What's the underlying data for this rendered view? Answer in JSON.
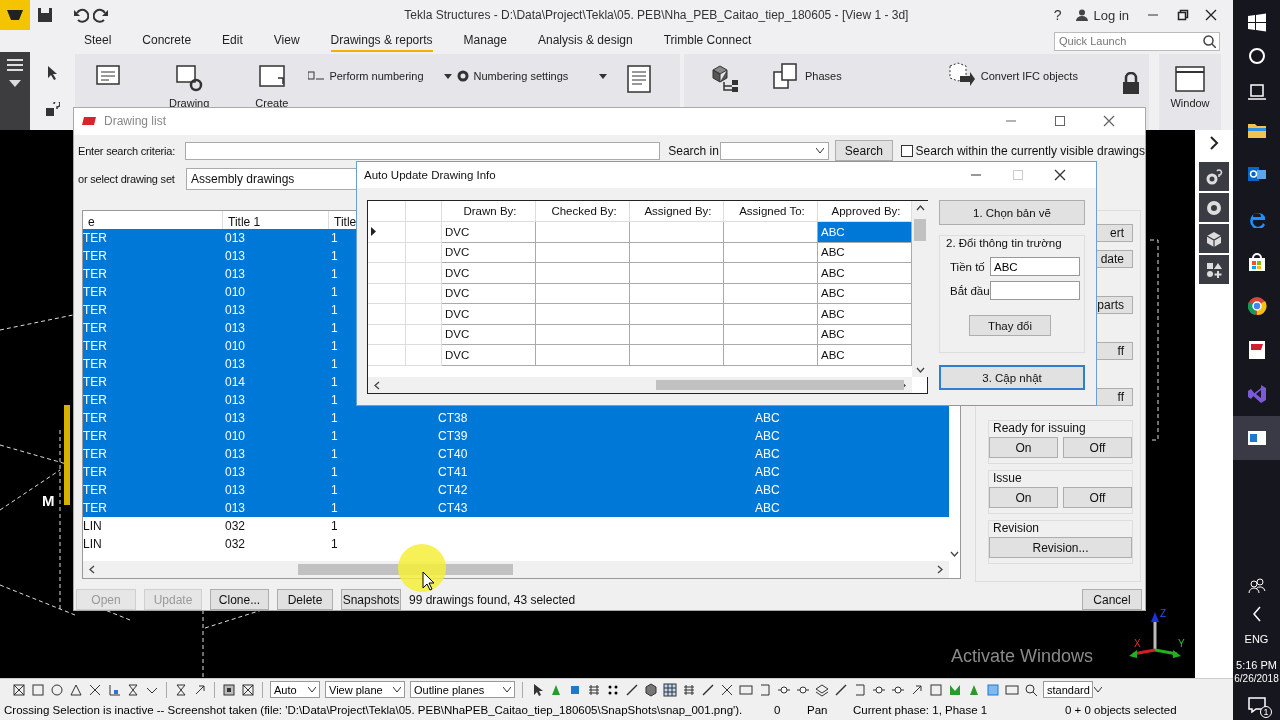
{
  "app_title": {
    "title": "Tekla Structures - D:\\Data\\Project\\Tekla\\05. PEB\\Nha_PEB_Caitao_tiep_180605 - [View 1 - 3d]",
    "help": "?",
    "login": "Log in"
  },
  "ribbon": {
    "tabs": [
      {
        "label": "Steel",
        "selected": false
      },
      {
        "label": "Concrete",
        "selected": false
      },
      {
        "label": "Edit",
        "selected": false
      },
      {
        "label": "View",
        "selected": false
      },
      {
        "label": "Drawings & reports",
        "selected": true
      },
      {
        "label": "Manage",
        "selected": false
      },
      {
        "label": "Analysis & design",
        "selected": false
      },
      {
        "label": "Trimble Connect",
        "selected": false
      }
    ],
    "quick_launch": {
      "placeholder": "Quick Launch"
    },
    "commands": [
      {
        "kind": "large",
        "label": "Drawing"
      },
      {
        "kind": "large",
        "label": "Create"
      },
      {
        "kind": "small",
        "label": "Perform numbering"
      },
      {
        "kind": "small",
        "label": "Numbering settings"
      },
      {
        "kind": "small",
        "label": "Phases"
      },
      {
        "kind": "small",
        "label": "Convert IFC objects"
      },
      {
        "kind": "large",
        "label": "Window"
      }
    ]
  },
  "drawing_list": {
    "title": "Drawing list",
    "search_label": "Enter search criteria:",
    "search_in_label": "Search in",
    "search_button": "Search",
    "visible_only": {
      "label": "Search within the currently visible drawings",
      "checked": false
    },
    "set_label": "or select drawing set",
    "set_value": "Assembly drawings",
    "table": {
      "columns": [
        "e",
        "Title 1",
        "Title"
      ],
      "rows": [
        {
          "name": "TER",
          "title_1": "013",
          "title": "1",
          "selected": true
        },
        {
          "name": "TER",
          "title_1": "013",
          "title": "1",
          "selected": true
        },
        {
          "name": "TER",
          "title_1": "013",
          "title": "1",
          "selected": true
        },
        {
          "name": "TER",
          "title_1": "010",
          "title": "1",
          "selected": true
        },
        {
          "name": "TER",
          "title_1": "013",
          "title": "1",
          "selected": true
        },
        {
          "name": "TER",
          "title_1": "013",
          "title": "1",
          "selected": true
        },
        {
          "name": "TER",
          "title_1": "010",
          "title": "1",
          "selected": true
        },
        {
          "name": "TER",
          "title_1": "013",
          "title": "1",
          "selected": true
        },
        {
          "name": "TER",
          "title_1": "014",
          "title": "1",
          "selected": true
        },
        {
          "name": "TER",
          "title_1": "013",
          "title": "1",
          "selected": true
        },
        {
          "name": "TER",
          "title_1": "013",
          "title": "1",
          "column_4": "CT38",
          "column_5": "ABC",
          "selected": true
        },
        {
          "name": "TER",
          "title_1": "010",
          "title": "1",
          "column_4": "CT39",
          "column_5": "ABC",
          "selected": true
        },
        {
          "name": "TER",
          "title_1": "013",
          "title": "1",
          "column_4": "CT40",
          "column_5": "ABC",
          "selected": true
        },
        {
          "name": "TER",
          "title_1": "013",
          "title": "1",
          "column_4": "CT41",
          "column_5": "ABC",
          "selected": true
        },
        {
          "name": "TER",
          "title_1": "013",
          "title": "1",
          "column_4": "CT42",
          "column_5": "ABC",
          "selected": true
        },
        {
          "name": "TER",
          "title_1": "013",
          "title": "1",
          "column_4": "CT43",
          "column_5": "ABC",
          "selected": true
        },
        {
          "name": "LIN",
          "title_1": "032",
          "title": "1",
          "selected": false
        },
        {
          "name": "LIN",
          "title_1": "032",
          "title": "1",
          "selected": false
        }
      ]
    },
    "partial_buttons": [
      "ert",
      "date",
      "parts",
      "ff",
      "ff"
    ],
    "groups": [
      {
        "label": "Ready for issuing",
        "buttons": [
          "On",
          "Off"
        ]
      },
      {
        "label": "Issue",
        "buttons": [
          "On",
          "Off"
        ]
      },
      {
        "label": "Revision",
        "buttons": [
          "Revision..."
        ]
      }
    ],
    "buttons": [
      {
        "label": "Open",
        "disabled": true
      },
      {
        "label": "Update",
        "disabled": true
      },
      {
        "label": "Clone...",
        "disabled": false
      },
      {
        "label": "Delete",
        "disabled": false
      },
      {
        "label": "Snapshots",
        "disabled": false
      }
    ],
    "status": "99 drawings found, 43 selected",
    "cancel": "Cancel"
  },
  "dialog": {
    "title": "Auto Update Drawing Info",
    "grid": {
      "columns": [
        "Drawn By:",
        "Checked By:",
        "Assigned By:",
        "Assigned To:",
        "Approved By:"
      ],
      "rows": [
        {
          "drawn_by": "DVC",
          "approved_by": "ABC",
          "current": true,
          "selected": true
        },
        {
          "drawn_by": "DVC",
          "approved_by": "ABC",
          "current": false,
          "selected": false
        },
        {
          "drawn_by": "DVC",
          "approved_by": "ABC",
          "current": false,
          "selected": false
        },
        {
          "drawn_by": "DVC",
          "approved_by": "ABC",
          "current": false,
          "selected": false
        },
        {
          "drawn_by": "DVC",
          "approved_by": "ABC",
          "current": false,
          "selected": false
        },
        {
          "drawn_by": "DVC",
          "approved_by": "ABC",
          "current": false,
          "selected": false
        },
        {
          "drawn_by": "DVC",
          "approved_by": "ABC",
          "current": false,
          "selected": false
        }
      ]
    },
    "choose_button": "1. Chọn bản vẽ",
    "group": {
      "label": "2. Đổi thông tin trường",
      "fields": [
        {
          "label": "Tiền tố",
          "value": "ABC"
        },
        {
          "label": "Bắt đầu"
        }
      ],
      "button": "Thay đổi"
    },
    "update_button": "3. Cập nhật"
  },
  "viewport": {
    "label": "M",
    "axes": [
      "Z",
      "X",
      "Y"
    ],
    "notice": "Activate Windows"
  },
  "toolbar": {
    "dropdowns": [
      "Auto",
      "View plane",
      "Outline planes",
      "standard"
    ]
  },
  "status_bar": {
    "message": "Crossing Selection is inactive -- Screenshot taken (file: 'D:\\Data\\Project\\Tekla\\05. PEB\\NhaPEB_Caitao_tiep_180605\\SnapShots\\snap_001.png').",
    "count": "0",
    "mode": "Pan",
    "phase": "Current phase: 1, Phase 1",
    "selection": "0 + 0 objects selected"
  },
  "taskbar": {
    "language": "ENG",
    "time": "5:16 PM",
    "date": "6/26/2018",
    "notifications": "1"
  }
}
